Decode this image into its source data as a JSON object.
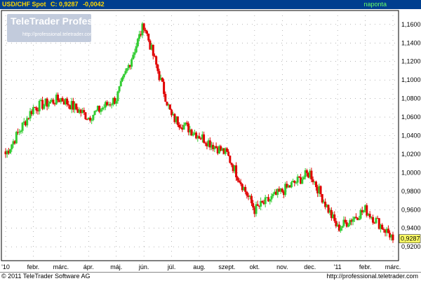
{
  "header": {
    "symbol": "USD/CHF Spot",
    "close_label": "C: 0,9287",
    "change": "-0,0042",
    "period": "naponta"
  },
  "logo": {
    "brand": "TeleTrader Professional",
    "url": "http://professional.teletrader.com"
  },
  "footer": {
    "copyright": "© 2011 TeleTrader Software AG",
    "url": "http://professional.teletrader.com"
  },
  "colors": {
    "up": "#33cc33",
    "down": "#e00000",
    "grid": "#888888",
    "header_bg": "#003f8f",
    "header_text": "#ffd700",
    "period_text": "#66ff66",
    "last_price_bg": "#ffff66"
  },
  "chart_data": {
    "type": "candlestick",
    "title": "USD/CHF Spot",
    "x_tick_labels": [
      "'10",
      "febr.",
      "márc.",
      "ápr.",
      "máj.",
      "jún.",
      "júl.",
      "aug.",
      "szept.",
      "okt.",
      "nov.",
      "dec.",
      "'11",
      "febr.",
      "márc."
    ],
    "y_tick_labels": [
      "0,9200",
      "0,9400",
      "0,9600",
      "0,9800",
      "1,0000",
      "1,0200",
      "1,0400",
      "1,0600",
      "1,0800",
      "1,1000",
      "1,1200",
      "1,1400",
      "1,1600"
    ],
    "ylim": [
      0.905,
      1.175
    ],
    "last_value_label": "0,9287",
    "grid": true,
    "legend": "none",
    "series_path": {
      "months": [
        "'10",
        "febr.",
        "márc.",
        "ápr.",
        "máj.",
        "jún.",
        "júl.",
        "aug.",
        "szept.",
        "okt.",
        "nov.",
        "dec.",
        "'11",
        "febr.",
        "márc."
      ],
      "anchor_values": [
        1.02,
        1.07,
        1.08,
        1.06,
        1.08,
        1.16,
        1.06,
        1.04,
        1.02,
        0.96,
        0.98,
        1.0,
        0.94,
        0.96,
        0.93
      ]
    }
  }
}
